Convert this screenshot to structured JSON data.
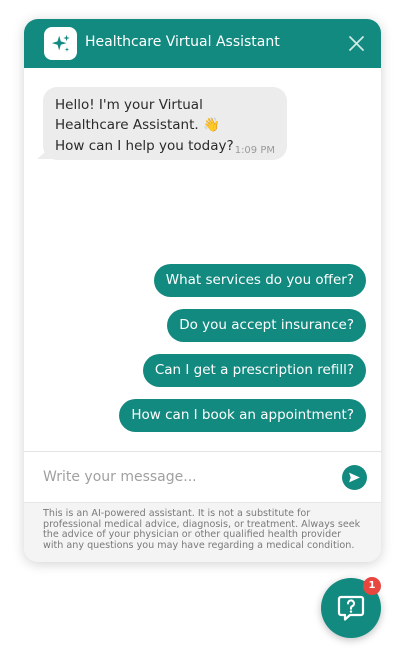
{
  "header": {
    "title": "Healthcare Virtual Assistant",
    "logo_icon": "sparkles-icon",
    "close_icon": "close-icon"
  },
  "messages": [
    {
      "from": "bot",
      "line1": "Hello! I'm your Virtual Healthcare Assistant. 👋",
      "line2": "How can I help you today?",
      "time": "1:09 PM"
    }
  ],
  "suggestions": [
    "What services do you offer?",
    "Do you accept insurance?",
    "Can I get a prescription refill?",
    "How can I book an appointment?"
  ],
  "composer": {
    "placeholder": "Write your message...",
    "send_icon": "send-icon"
  },
  "disclaimer": "This is an AI-powered assistant. It is not a substitute for professional medical advice, diagnosis, or treatment. Always seek the advice of your physician or other qualified health provider with any questions you may have regarding a medical condition.",
  "launcher": {
    "icon": "chat-question-icon",
    "badge_count": "1"
  },
  "colors": {
    "primary": "#128a80",
    "bot_bubble": "#ececec",
    "badge": "#e8473f"
  }
}
